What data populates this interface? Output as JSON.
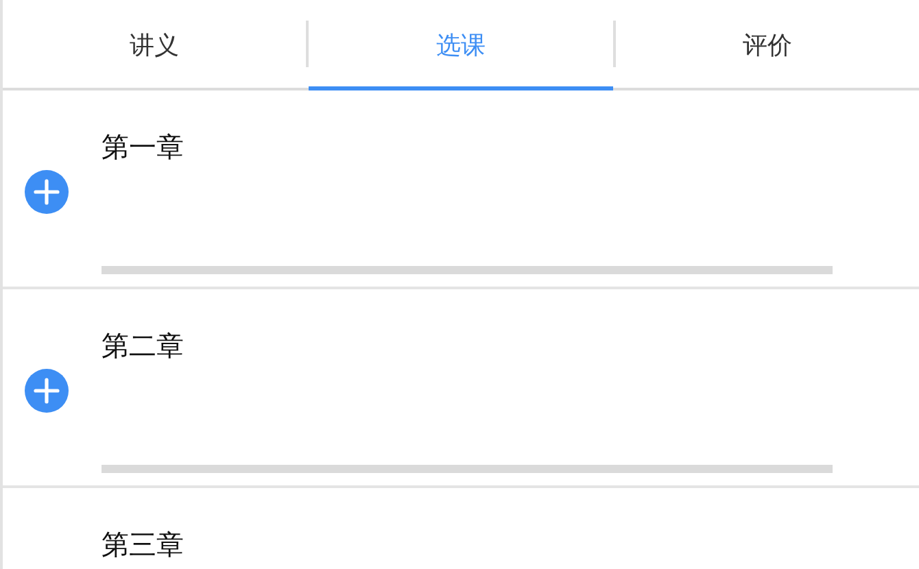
{
  "tabs": [
    {
      "label": "讲义",
      "selected": false
    },
    {
      "label": "选课",
      "selected": true
    },
    {
      "label": "评价",
      "selected": false
    }
  ],
  "chapters": [
    {
      "title": "第一章",
      "add_button": true
    },
    {
      "title": "第二章",
      "add_button": true
    },
    {
      "title": "第三章",
      "add_button": false
    }
  ]
}
